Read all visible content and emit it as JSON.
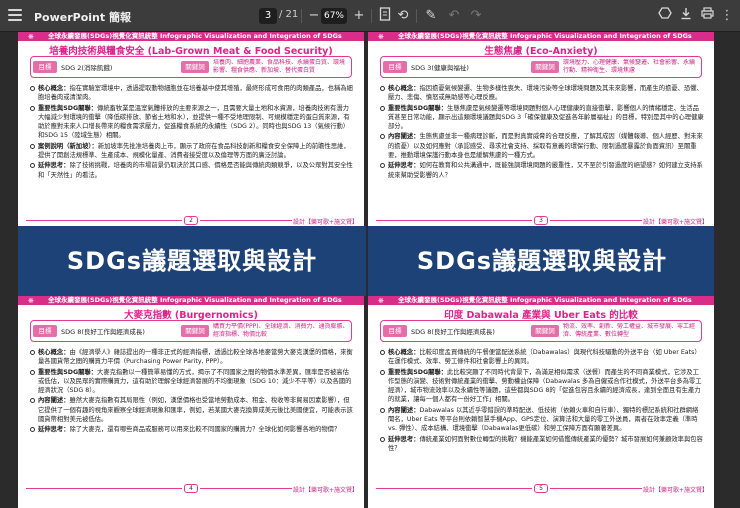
{
  "app": {
    "title": "PowerPoint 簡報",
    "current_page": "3",
    "page_count": "/ 21",
    "zoom": "67%",
    "icons": [
      "menu-icon",
      "minus-icon",
      "plus-icon",
      "fit-page-icon",
      "rotate-icon",
      "annotate-icon",
      "undo-icon",
      "redo-icon",
      "drive-icon",
      "download-icon",
      "print-icon",
      "more-icon"
    ]
  },
  "header_text": "全球永續發展(SDGs)視覺化資訊統整 Infographic Visualization and Integration of SDGs",
  "labels": {
    "goal": "目標",
    "keywords": "關鍵詞"
  },
  "credit": "設計【樂可歌+施文賢】",
  "band_title": "SDGs議題選取與設計",
  "pages": [
    {
      "title": "培養肉技術與糧食安全 (Lab-Grown Meat & Food Security)",
      "goal": "SDG 2(消除飢餓)",
      "keywords": "培養肉、細胞農業、食品科技、永續蛋白質、環境影響、糧食供應、新加坡、替代蛋白質",
      "number": "2",
      "items": [
        {
          "h": "核心概念：",
          "t": "指在實驗室環境中，透過提取動物細胞並在培養基中使其增殖，最終形成可食用的肉類產品，也稱為細胞培養肉或清潔肉。"
        },
        {
          "h": "重要性與SDG關聯：",
          "t": "傳統畜牧業是溫室氣體排放的主要來源之一，且需要大量土地和水資源，培養肉技術有潛力大幅減少對環境的衝擊（降低碳排放、節省土地和水），並提供一種不受地理限制、可規模穩定的蛋白質來源，有助於應對未來人口增長帶來的糧食需求壓力，促進糧食系統的永續性（SDG 2）。同時也與SDG 13（氣候行動）和SDG 15（陸域生態）相關。"
        },
        {
          "h": "案例說明（新加坡）：",
          "t": "新加坡率先批准培養肉上市，顯示了政府在食品科技創新和糧食安全保障上的前瞻性思維，提供了開創法規標準、生產成本、規模化量產、消費者接受度以及倫理等方面的廣泛討論。"
        },
        {
          "h": "延伸思考：",
          "t": "除了技術挑戰，培養肉的市場前景仍取決於其口感、價格是否能與傳統肉類競爭，以及公眾對其安全性和「天然性」的看法。"
        }
      ]
    },
    {
      "title": "生態焦慮 (Eco-Anxiety)",
      "goal": "SDG 3(健康與福祉)",
      "keywords": "環境壓力、心理健康、氣候變遷、社會影響、永續行動、精神衛生、環境焦慮",
      "number": "3",
      "items": [
        {
          "h": "核心概念：",
          "t": "指因擔憂氣候變遷、生物多樣性喪失、環境污染等全球環境問題及其未來影響，而產生的擔憂、恐懼、壓力、悲傷、憤怒或無助感等心理反應。"
        },
        {
          "h": "重要性與SDG關聯：",
          "t": "生態焦慮是氣候變遷等環境問題對個人心理健康的直接衝擊，影響個人的情緒穩定、生活品質甚至日常功能，顯示出這類環境議題與SDG 3「確保健康及促進各年齡層福祉」的目標，特別是其中的心理健康部分。"
        },
        {
          "h": "內容闡述：",
          "t": "生態焦慮並非一種病理診斷，而是對真實威脅的合理反應，了解其成因（媒體報導、個人經歷、對未來的擔憂）以及如何應對（承認感受、尋求社會支持、採取有意義的環保行動、限制過度暴露於負面資訊）至關重要，推動環境保護行動本身也是緩解焦慮的一種方式。"
        },
        {
          "h": "延伸思考：",
          "t": "如何在教育和公共溝通中，既能強調環境問題的嚴重性，又不至於引發過度的絕望感？如何建立支持系統來幫助受影響的人？"
        }
      ]
    },
    {
      "title": "大麥克指數 (Burgernomics)",
      "goal": "SDG 8(良好工作與經濟成長)",
      "keywords": "購買力平價(PPP)、全球經濟、消費力、通貨膨脹、經濟指標、物價比較",
      "number": "4",
      "items": [
        {
          "h": "核心概念：",
          "t": "由《經濟學人》雜誌提出的一種非正式的經濟指標，透過比較全球各地麥當勞大麥克漢堡的價格，來衡量各國貨幣之間的購買力平價（Purchasing Power Parity, PPP）。"
        },
        {
          "h": "重要性與SDG關聯：",
          "t": "大麥克指數以一種簡單易懂的方式，揭示了不同國家之間的物價水準差異，匯率是否被高估或低估，以及民眾的實際購買力，這有助於理解全球經濟發展的不均衡現象（SDG 10：減少不平等）以及各國的經濟狀況（SDG 8）。"
        },
        {
          "h": "內容闡述：",
          "t": "雖然大麥克指數有其局限性（例如，漢堡價格也受當地勞動成本、租金、稅收等非貿易因素影響），但它提供了一個有趣的視角來觀察全球經濟現象和匯率，例如，若某國大麥克換算成美元後比美國便宜，可能表示該國貨幣相對美元被低估。"
        },
        {
          "h": "延伸思考：",
          "t": "除了大麥克，還有哪些商品或服務可以用來比較不同國家的購買力？全球化如何影響各地的物價？"
        }
      ]
    },
    {
      "title": "印度 Dabawala 產業與 Uber Eats 的比較",
      "goal": "SDG 8(良好工作與經濟成長)",
      "keywords": "物流、效率、創新、勞工權益、城市發展、零工經濟、傳統產業、數位轉型",
      "number": "5",
      "items": [
        {
          "h": "核心概念：",
          "t": "比較印度孟買傳統的午餐便當配送系統（Dabawalas）與現代科技驅動的外送平台（如 Uber Eats）在運作模式、效率、勞工條件和社會影響上的異同。"
        },
        {
          "h": "重要性與SDG關聯：",
          "t": "此比較突顯了不同時代背景下，為滿足相似需求（送餐）而產生的不同商業模式，它涉及工作型態的演變、技術對傳統產業的衝擊、勞動權益保障（Dabawalas 多為自僱或合作社模式，外送平台多為零工經濟），城市物流效率以及永續性等議題，這些都與SDG 8的「促進包容且永續的經濟成長，達到全面且有生產力的就業，讓每一個人都有一份好工作」相關。"
        },
        {
          "h": "內容闡述：",
          "t": "Dabawalas 以其近乎零錯誤的準時配送、低技術（依賴火車和自行車）、獨特的標記系統和社群網絡聞名，Uber Eats 等平台則依賴智慧手機App、GPS定位、演算法和大量的零工外送員，兩者在效率定義（準時 vs. 彈性）、成本結構、環境衝擊（Dabawalas更低碳）和勞工保障方面有顯著差異。"
        },
        {
          "h": "延伸思考：",
          "t": "傳統產業如何面對數位轉型的挑戰？機能產業如何借鑑傳統產業的優勢？城市發展如何兼顧效率與包容性？"
        }
      ]
    }
  ]
}
